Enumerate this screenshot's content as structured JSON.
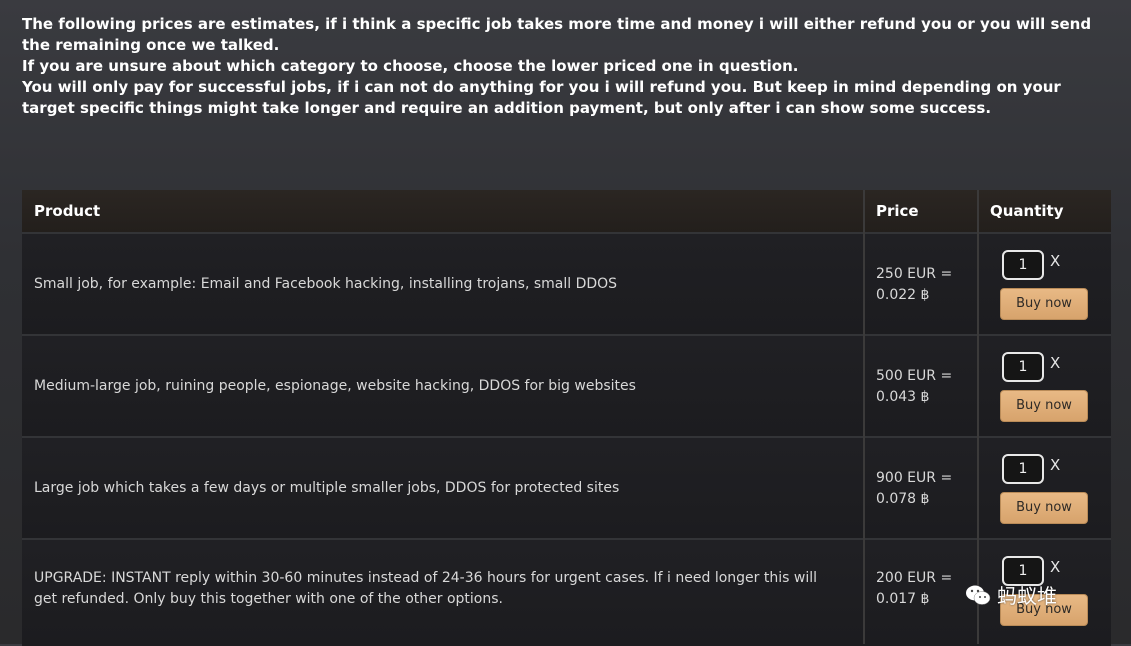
{
  "intro": {
    "line1": "The following prices are estimates, if i think a specific job takes more time and money i will either refund you or you will send the remaining once we talked.",
    "line2": "If you are unsure about which category to choose, choose the lower priced one in question.",
    "line3": "You will only pay for successful jobs, if i can not do anything for you i will refund you. But keep in mind depending on your target specific things might take longer and require an addition payment, but only after i can show some success."
  },
  "table": {
    "headers": {
      "product": "Product",
      "price": "Price",
      "quantity": "Quantity"
    },
    "rows": [
      {
        "product": "Small job, for example: Email and Facebook hacking, installing trojans, small DDOS",
        "price_eur": "250 EUR =",
        "price_btc": "0.022 ฿",
        "quantity": "1",
        "times": "X",
        "buy_label": "Buy now"
      },
      {
        "product": "Medium-large job, ruining people, espionage, website hacking, DDOS for big websites",
        "price_eur": "500 EUR =",
        "price_btc": "0.043 ฿",
        "quantity": "1",
        "times": "X",
        "buy_label": "Buy now"
      },
      {
        "product": "Large job which takes a few days or multiple smaller jobs, DDOS for protected sites",
        "price_eur": "900 EUR =",
        "price_btc": "0.078 ฿",
        "quantity": "1",
        "times": "X",
        "buy_label": "Buy now"
      },
      {
        "product": "UPGRADE: INSTANT reply within 30-60 minutes instead of 24-36 hours for urgent cases. If i need longer this will get refunded. Only buy this together with one of the other options.",
        "price_eur": "200 EUR =",
        "price_btc": "0.017 ฿",
        "quantity": "1",
        "times": "X",
        "buy_label": "Buy now"
      }
    ]
  },
  "watermark": {
    "text": "蚂蚁堆",
    "icon": "wechat-icon"
  },
  "colors": {
    "button": "#dca872",
    "background": "#2f3034",
    "row": "#1e1e21"
  }
}
